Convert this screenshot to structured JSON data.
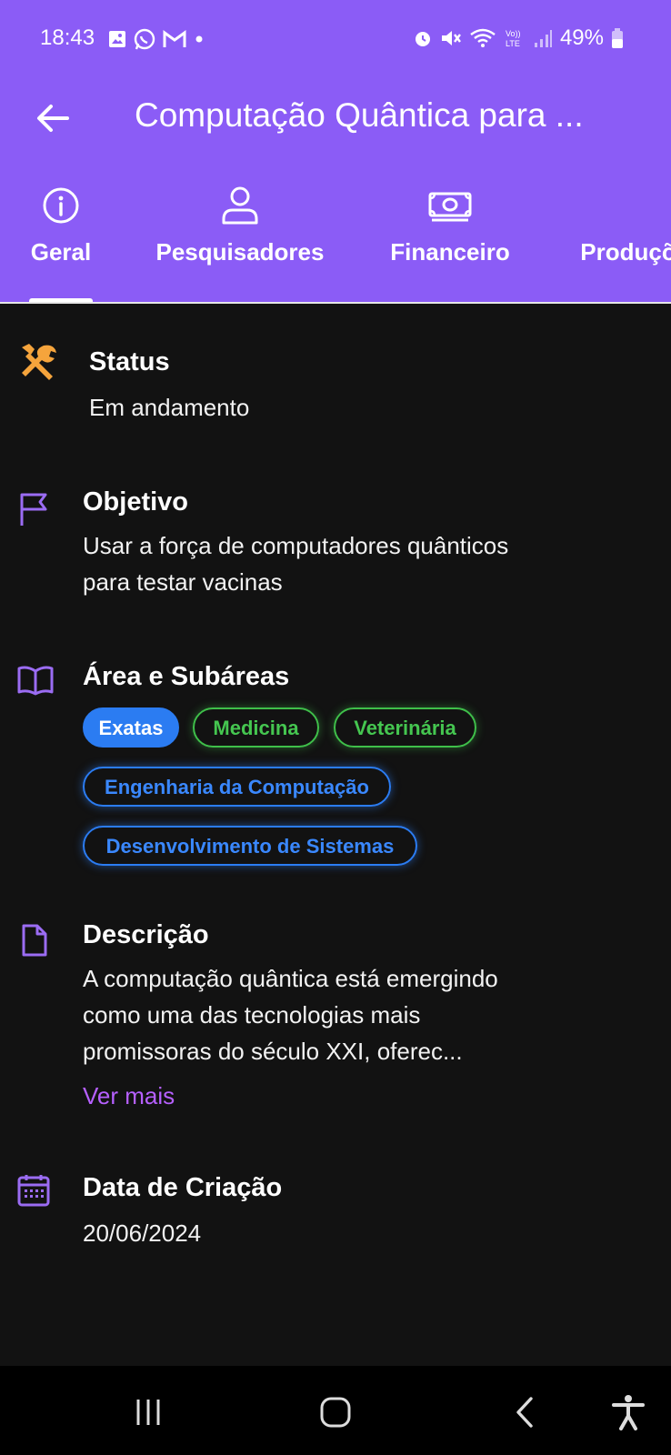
{
  "status_bar": {
    "time": "18:43",
    "battery": "49%",
    "left_icons": [
      "image-icon",
      "whatsapp-icon",
      "gmail-icon",
      "dot-icon"
    ],
    "right_icons": [
      "alarm-icon",
      "mute-icon",
      "wifi-icon",
      "volte-icon",
      "signal-icon",
      "battery-icon"
    ]
  },
  "appbar": {
    "title": "Computação Quântica para ..."
  },
  "tabs": [
    {
      "label": "Geral",
      "icon": "info-icon",
      "selected": true
    },
    {
      "label": "Pesquisadores",
      "icon": "person-icon",
      "selected": false
    },
    {
      "label": "Financeiro",
      "icon": "money-icon",
      "selected": false
    },
    {
      "label": "Produçõ",
      "icon": "production-icon",
      "selected": false
    }
  ],
  "sections": {
    "status": {
      "title": "Status",
      "value": "Em andamento",
      "icon": "tools-icon"
    },
    "objetivo": {
      "title": "Objetivo",
      "line1": "Usar a força de computadores quânticos",
      "line2": "para testar vacinas",
      "icon": "flag-icon"
    },
    "area": {
      "title": "Área e Subáreas",
      "icon": "book-icon",
      "chips": [
        {
          "label": "Exatas",
          "style": "filled-blue"
        },
        {
          "label": "Medicina",
          "style": "outline-green"
        },
        {
          "label": "Veterinária",
          "style": "outline-green"
        },
        {
          "label": "Engenharia da Computação",
          "style": "outline-blue"
        },
        {
          "label": "Desenvolvimento de Sistemas",
          "style": "outline-blue"
        }
      ]
    },
    "descricao": {
      "title": "Descrição",
      "icon": "document-icon",
      "line1": "A computação quântica está emergindo",
      "line2": "como uma das tecnologias mais",
      "line3": "promissoras do século XXI, oferec...",
      "more": "Ver mais"
    },
    "data": {
      "title": "Data de Criação",
      "value": "20/06/2024",
      "icon": "calendar-icon"
    }
  },
  "colors": {
    "header": "#8b5cf6",
    "background": "#121212",
    "accent_purple": "#9b6cf3",
    "status_icon_orange": "#f5a43c",
    "chip_blue": "#2b7cf2",
    "chip_green": "#3fbf4a",
    "link_purple": "#b660ff"
  },
  "nav_bar": {
    "buttons": [
      "recents-icon",
      "home-icon",
      "back-icon",
      "accessibility-icon"
    ]
  }
}
